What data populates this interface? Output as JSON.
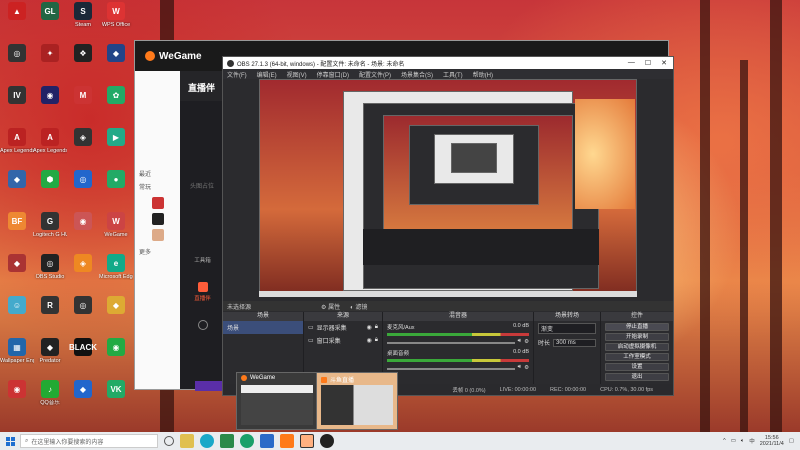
{
  "desktop_icons": [
    {
      "label": "",
      "color": "#c22",
      "glyph": "▲"
    },
    {
      "label": "",
      "color": "#264",
      "glyph": "GL"
    },
    {
      "label": "Steam",
      "color": "#1b2838",
      "glyph": "S"
    },
    {
      "label": "WPS Office",
      "color": "#d33",
      "glyph": "W"
    },
    {
      "label": "",
      "color": "#333",
      "glyph": "◎"
    },
    {
      "label": "",
      "color": "#a22",
      "glyph": "✦"
    },
    {
      "label": "",
      "color": "#222",
      "glyph": "❖"
    },
    {
      "label": "",
      "color": "#248",
      "glyph": "◆"
    },
    {
      "label": "",
      "color": "#333",
      "glyph": "IV"
    },
    {
      "label": "",
      "color": "#226",
      "glyph": "◉"
    },
    {
      "label": "",
      "color": "#c33",
      "glyph": "M"
    },
    {
      "label": "",
      "color": "#2a6",
      "glyph": "✿"
    },
    {
      "label": "Apex Legends",
      "color": "#b22",
      "glyph": "A"
    },
    {
      "label": "Apex Legends",
      "color": "#b22",
      "glyph": "A"
    },
    {
      "label": "",
      "color": "#333",
      "glyph": "◈"
    },
    {
      "label": "",
      "color": "#2a8",
      "glyph": "▶"
    },
    {
      "label": "",
      "color": "#36a",
      "glyph": "◆"
    },
    {
      "label": "",
      "color": "#2a4",
      "glyph": "⬢"
    },
    {
      "label": "",
      "color": "#26c",
      "glyph": "◎"
    },
    {
      "label": "",
      "color": "#2a6",
      "glyph": "●"
    },
    {
      "label": "",
      "color": "#e83",
      "glyph": "BF"
    },
    {
      "label": "Logitech G HUB",
      "color": "#333",
      "glyph": "G"
    },
    {
      "label": "",
      "color": "#c55",
      "glyph": "◉"
    },
    {
      "label": "WeGame",
      "color": "#c44",
      "glyph": "W"
    },
    {
      "label": "",
      "color": "#a33",
      "glyph": "◆"
    },
    {
      "label": "OBS Studio",
      "color": "#222",
      "glyph": "◎"
    },
    {
      "label": "",
      "color": "#e82",
      "glyph": "◈"
    },
    {
      "label": "Microsoft Edge",
      "color": "#1a8",
      "glyph": "e"
    },
    {
      "label": "",
      "color": "#4ac",
      "glyph": "☺"
    },
    {
      "label": "",
      "color": "#333",
      "glyph": "R"
    },
    {
      "label": "",
      "color": "#333",
      "glyph": "◎"
    },
    {
      "label": "",
      "color": "#da3",
      "glyph": "◆"
    },
    {
      "label": "Wallpaper Engine",
      "color": "#26a",
      "glyph": "▦"
    },
    {
      "label": "Predator",
      "color": "#222",
      "glyph": "◆"
    },
    {
      "label": "",
      "color": "#111",
      "glyph": "BLACK"
    },
    {
      "label": "",
      "color": "#2a4",
      "glyph": "◉"
    },
    {
      "label": "",
      "color": "#c33",
      "glyph": "◉"
    },
    {
      "label": "QQ音乐",
      "color": "#2a3",
      "glyph": "♪"
    },
    {
      "label": "",
      "color": "#26c",
      "glyph": "◆"
    },
    {
      "label": "",
      "color": "#2a6",
      "glyph": "VK"
    }
  ],
  "wegame": {
    "logo": "WeGame",
    "live_header": "直播伴",
    "left_items": [
      "最近",
      "常玩"
    ],
    "more": "更多",
    "nav": [
      {
        "label": "工具箱",
        "active": false
      },
      {
        "label": "直播伴",
        "active": true
      },
      {
        "label": "",
        "active": false
      }
    ],
    "side_note": "头图占位"
  },
  "obs": {
    "title": "OBS 27.1.3 (64-bit, windows) - 配置文件: 未命名 - 场景: 未命名",
    "menu": [
      "文件(F)",
      "编辑(E)",
      "视图(V)",
      "停靠窗口(D)",
      "配置文件(P)",
      "场景集合(S)",
      "工具(T)",
      "帮助(H)"
    ],
    "status_line": "未选择源",
    "status_actions": [
      "属性",
      "滤镜"
    ],
    "docks": {
      "scenes": {
        "header": "场景",
        "items": [
          "场景"
        ]
      },
      "sources": {
        "header": "来源",
        "items": [
          "显示器采集",
          "窗口采集"
        ]
      },
      "mixer": {
        "header": "混音器",
        "tracks": [
          {
            "name": "麦克风/Aux",
            "db": "0.0 dB"
          },
          {
            "name": "桌面音频",
            "db": "0.0 dB"
          }
        ]
      },
      "transitions": {
        "header": "场景转场",
        "type": "渐变",
        "duration_label": "时长",
        "duration": "300 ms"
      },
      "controls": {
        "header": "控件",
        "buttons": [
          "停止直播",
          "开始录制",
          "启动虚拟摄像机",
          "工作室模式",
          "设置",
          "退出"
        ]
      }
    },
    "bottom_status": [
      "丢帧 0 (0.0%)",
      "LIVE: 00:00:00",
      "REC: 00:00:00",
      "CPU: 0.7%, 30.00 fps"
    ]
  },
  "thumbnails": [
    {
      "title": "WeGame"
    },
    {
      "title": "斗鱼直播"
    }
  ],
  "taskbar": {
    "search_placeholder": "在这里输入你要搜索的内容",
    "time": "15:56",
    "date": "2021/11/4"
  },
  "colors": {
    "obs_bg": "#2b2b2e",
    "accent": "#ff5d3a",
    "wegame_orange": "#ff7a1a"
  }
}
